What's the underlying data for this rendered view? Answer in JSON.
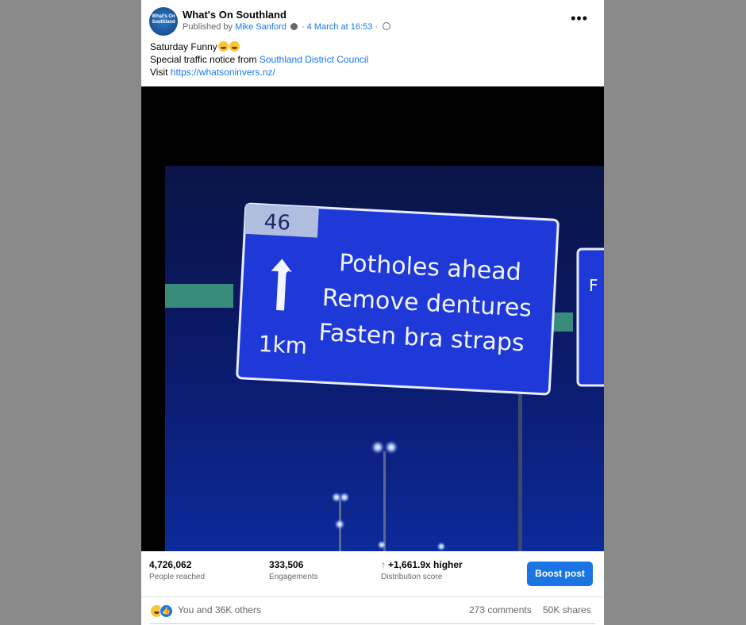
{
  "post": {
    "page_name": "What's On Southland",
    "avatar_text": "What's On Southland",
    "published_by_prefix": "Published by",
    "author": "Mike Sanford",
    "separator": "·",
    "timestamp": "4 March at 16:53",
    "line1": "Saturday Funny",
    "line2_prefix": "Special traffic notice from",
    "line2_link": "Southland District Council",
    "line3_prefix": "Visit",
    "line3_link": "https://whatsoninvers.nz/",
    "more_label": "•••"
  },
  "sign": {
    "route_number": "46",
    "line1": "Potholes ahead",
    "line2": "Remove dentures",
    "line3": "Fasten bra straps",
    "distance": "1km",
    "side_sign_text": "F E (I"
  },
  "stats": {
    "reach_value": "4,726,062",
    "reach_label": "People reached",
    "engagements_value": "333,506",
    "engagements_label": "Engagements",
    "distribution_value": "+1,661.9x higher",
    "distribution_label": "Distribution score",
    "boost_label": "Boost post"
  },
  "reactions": {
    "text": "You and 36K others",
    "comments": "273 comments",
    "shares": "50K shares"
  },
  "colors": {
    "link": "#1877f2",
    "boost_button": "#1b74e4",
    "sign_blue": "#1f39d9",
    "positive": "#31a24c"
  }
}
